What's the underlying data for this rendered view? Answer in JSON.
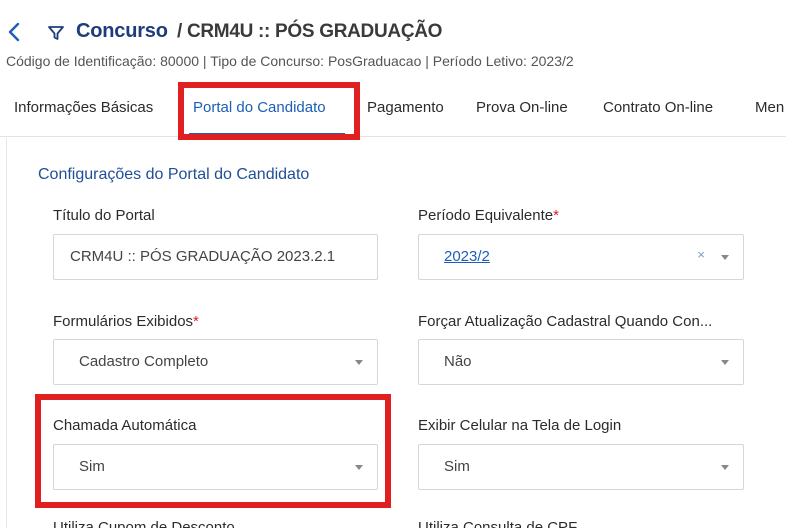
{
  "header": {
    "title": "Concurso",
    "subtitle": "/ CRM4U :: PÓS GRADUAÇÃO",
    "info": "Código de Identificação: 80000 | Tipo de Concurso: PosGraduacao | Período Letivo: 2023/2",
    "back_icon": "chevron-left-icon",
    "filter_icon": "filter-icon"
  },
  "tabs": [
    {
      "label": "Informações Básicas"
    },
    {
      "label": "Portal do Candidato",
      "active": true
    },
    {
      "label": "Pagamento"
    },
    {
      "label": "Prova On-line"
    },
    {
      "label": "Contrato On-line"
    },
    {
      "label": "Men"
    }
  ],
  "section": {
    "title": "Configurações do Portal do Candidato"
  },
  "form": {
    "titulo_portal": {
      "label": "Título do Portal",
      "value": "CRM4U :: PÓS GRADUAÇÃO 2023.2.1"
    },
    "periodo_equivalente": {
      "label": "Período Equivalente",
      "required": "*",
      "value": "2023/2",
      "clear": "×"
    },
    "formularios_exibidos": {
      "label": "Formulários Exibidos",
      "required": "*",
      "value": "Cadastro Completo"
    },
    "forcar_atualizacao": {
      "label": "Forçar Atualização Cadastral Quando Con...",
      "value": "Não"
    },
    "chamada_automatica": {
      "label": "Chamada Automática",
      "value": "Sim"
    },
    "exibir_celular": {
      "label": "Exibir Celular na Tela de Login",
      "value": "Sim"
    },
    "cut_left": {
      "label": "Utiliza Cupom de Desconto"
    },
    "cut_right": {
      "label": "Utiliza Consulta de CPF"
    }
  },
  "colors": {
    "accent": "#1c5fb8",
    "title": "#1f3d7a",
    "highlight": "#e02020"
  }
}
